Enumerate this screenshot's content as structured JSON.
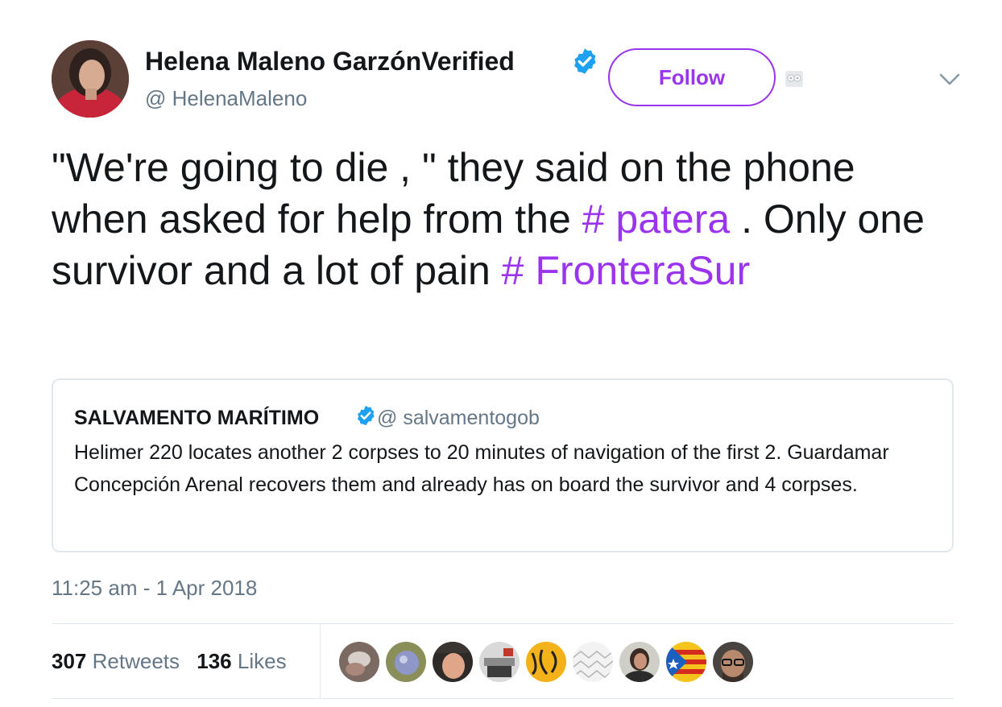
{
  "author": {
    "name": "Helena Maleno Garzón",
    "verified_label": "Verified",
    "handle": "@ HelenaMaleno"
  },
  "follow_label": "Follow",
  "tweet": {
    "text_before": "\"We're going to die , \" they said on the phone when asked for help from the ",
    "hashtag1": "# patera",
    "text_middle": " . Only one survivor and a lot of pain ",
    "hashtag2": "# FronteraSur"
  },
  "quoted": {
    "name": "SALVAMENTO MARÍTIMO",
    "handle": "@ salvamentogob",
    "text": "Helimer 220 locates another 2 corpses to 20 minutes of navigation of the first 2. Guardamar Concepción Arenal recovers them and already has on board the survivor and 4 corpses."
  },
  "timestamp": "11:25 am - 1 Apr 2018",
  "stats": {
    "retweets_count": "307",
    "retweets_label": "Retweets",
    "likes_count": "136",
    "likes_label": "Likes"
  },
  "icons": {
    "verified": "verified-badge-icon",
    "chevron": "chevron-down-icon",
    "extension": "owl-extension-icon"
  },
  "colors": {
    "accent": "#9b34ef",
    "verified": "#1da1f2",
    "muted": "#657786",
    "border": "#e1e8ed"
  }
}
